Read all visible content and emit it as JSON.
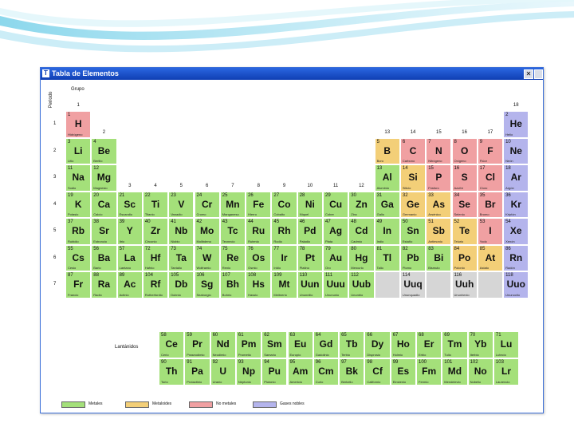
{
  "window": {
    "title": "Tabla de Elementos",
    "icon_name": "app-icon",
    "close_glyph": "✕"
  },
  "labels": {
    "periodo": "Periodo",
    "grupo": "Grupo",
    "lantanidos": "Lantánidos",
    "actinidos": "Actínidos",
    "lant_row": "6",
    "act_row": "7"
  },
  "groups": [
    "1",
    "2",
    "3",
    "4",
    "5",
    "6",
    "7",
    "8",
    "9",
    "10",
    "11",
    "12",
    "13",
    "14",
    "15",
    "16",
    "17",
    "18"
  ],
  "periods": [
    "1",
    "2",
    "3",
    "4",
    "5",
    "6",
    "7"
  ],
  "colors": {
    "metal": "#a4e07a",
    "metaloide": "#f3cf78",
    "nometal": "#f0a0a2",
    "noble": "#b4b4ec",
    "unknown": "#d6d6d6"
  },
  "legend": [
    {
      "label": "Metales",
      "cat": "metal"
    },
    {
      "label": "Metaloides",
      "cat": "metaloide"
    },
    {
      "label": "No metales",
      "cat": "nometal"
    },
    {
      "label": "Gases nobles",
      "cat": "noble"
    }
  ],
  "elements": [
    {
      "n": "1",
      "s": "H",
      "name": "Hidrógeno",
      "p": 1,
      "g": 1,
      "c": "nometal"
    },
    {
      "n": "2",
      "s": "He",
      "name": "Helio",
      "p": 1,
      "g": 18,
      "c": "noble"
    },
    {
      "n": "3",
      "s": "Li",
      "name": "Litio",
      "p": 2,
      "g": 1,
      "c": "metal"
    },
    {
      "n": "4",
      "s": "Be",
      "name": "Berilio",
      "p": 2,
      "g": 2,
      "c": "metal"
    },
    {
      "n": "5",
      "s": "B",
      "name": "Boro",
      "p": 2,
      "g": 13,
      "c": "metaloide"
    },
    {
      "n": "6",
      "s": "C",
      "name": "Carbono",
      "p": 2,
      "g": 14,
      "c": "nometal"
    },
    {
      "n": "7",
      "s": "N",
      "name": "Nitrógeno",
      "p": 2,
      "g": 15,
      "c": "nometal"
    },
    {
      "n": "8",
      "s": "O",
      "name": "Oxígeno",
      "p": 2,
      "g": 16,
      "c": "nometal"
    },
    {
      "n": "9",
      "s": "F",
      "name": "Flúor",
      "p": 2,
      "g": 17,
      "c": "nometal"
    },
    {
      "n": "10",
      "s": "Ne",
      "name": "Neón",
      "p": 2,
      "g": 18,
      "c": "noble"
    },
    {
      "n": "11",
      "s": "Na",
      "name": "Sodio",
      "p": 3,
      "g": 1,
      "c": "metal"
    },
    {
      "n": "12",
      "s": "Mg",
      "name": "Magnesio",
      "p": 3,
      "g": 2,
      "c": "metal"
    },
    {
      "n": "13",
      "s": "Al",
      "name": "Aluminio",
      "p": 3,
      "g": 13,
      "c": "metal"
    },
    {
      "n": "14",
      "s": "Si",
      "name": "Silicio",
      "p": 3,
      "g": 14,
      "c": "metaloide"
    },
    {
      "n": "15",
      "s": "P",
      "name": "Fósforo",
      "p": 3,
      "g": 15,
      "c": "nometal"
    },
    {
      "n": "16",
      "s": "S",
      "name": "Azufre",
      "p": 3,
      "g": 16,
      "c": "nometal"
    },
    {
      "n": "17",
      "s": "Cl",
      "name": "Cloro",
      "p": 3,
      "g": 17,
      "c": "nometal"
    },
    {
      "n": "18",
      "s": "Ar",
      "name": "Argón",
      "p": 3,
      "g": 18,
      "c": "noble"
    },
    {
      "n": "19",
      "s": "K",
      "name": "Potasio",
      "p": 4,
      "g": 1,
      "c": "metal"
    },
    {
      "n": "20",
      "s": "Ca",
      "name": "Calcio",
      "p": 4,
      "g": 2,
      "c": "metal"
    },
    {
      "n": "21",
      "s": "Sc",
      "name": "Escandio",
      "p": 4,
      "g": 3,
      "c": "metal"
    },
    {
      "n": "22",
      "s": "Ti",
      "name": "Titanio",
      "p": 4,
      "g": 4,
      "c": "metal"
    },
    {
      "n": "23",
      "s": "V",
      "name": "Vanadio",
      "p": 4,
      "g": 5,
      "c": "metal"
    },
    {
      "n": "24",
      "s": "Cr",
      "name": "Cromo",
      "p": 4,
      "g": 6,
      "c": "metal"
    },
    {
      "n": "25",
      "s": "Mn",
      "name": "Manganeso",
      "p": 4,
      "g": 7,
      "c": "metal"
    },
    {
      "n": "26",
      "s": "Fe",
      "name": "Hierro",
      "p": 4,
      "g": 8,
      "c": "metal"
    },
    {
      "n": "27",
      "s": "Co",
      "name": "Cobalto",
      "p": 4,
      "g": 9,
      "c": "metal"
    },
    {
      "n": "28",
      "s": "Ni",
      "name": "Níquel",
      "p": 4,
      "g": 10,
      "c": "metal"
    },
    {
      "n": "29",
      "s": "Cu",
      "name": "Cobre",
      "p": 4,
      "g": 11,
      "c": "metal"
    },
    {
      "n": "30",
      "s": "Zn",
      "name": "Zinc",
      "p": 4,
      "g": 12,
      "c": "metal"
    },
    {
      "n": "31",
      "s": "Ga",
      "name": "Galio",
      "p": 4,
      "g": 13,
      "c": "metal"
    },
    {
      "n": "32",
      "s": "Ge",
      "name": "Germanio",
      "p": 4,
      "g": 14,
      "c": "metaloide"
    },
    {
      "n": "33",
      "s": "As",
      "name": "Arsénico",
      "p": 4,
      "g": 15,
      "c": "metaloide"
    },
    {
      "n": "34",
      "s": "Se",
      "name": "Selenio",
      "p": 4,
      "g": 16,
      "c": "nometal"
    },
    {
      "n": "35",
      "s": "Br",
      "name": "Bromo",
      "p": 4,
      "g": 17,
      "c": "nometal"
    },
    {
      "n": "36",
      "s": "Kr",
      "name": "Kriptón",
      "p": 4,
      "g": 18,
      "c": "noble"
    },
    {
      "n": "37",
      "s": "Rb",
      "name": "Rubidio",
      "p": 5,
      "g": 1,
      "c": "metal"
    },
    {
      "n": "38",
      "s": "Sr",
      "name": "Estroncio",
      "p": 5,
      "g": 2,
      "c": "metal"
    },
    {
      "n": "39",
      "s": "Y",
      "name": "Itrio",
      "p": 5,
      "g": 3,
      "c": "metal"
    },
    {
      "n": "40",
      "s": "Zr",
      "name": "Circonio",
      "p": 5,
      "g": 4,
      "c": "metal"
    },
    {
      "n": "41",
      "s": "Nb",
      "name": "Niobio",
      "p": 5,
      "g": 5,
      "c": "metal"
    },
    {
      "n": "42",
      "s": "Mo",
      "name": "Molibdeno",
      "p": 5,
      "g": 6,
      "c": "metal"
    },
    {
      "n": "43",
      "s": "Tc",
      "name": "Tecnecio",
      "p": 5,
      "g": 7,
      "c": "metal"
    },
    {
      "n": "44",
      "s": "Ru",
      "name": "Rutenio",
      "p": 5,
      "g": 8,
      "c": "metal"
    },
    {
      "n": "45",
      "s": "Rh",
      "name": "Rodio",
      "p": 5,
      "g": 9,
      "c": "metal"
    },
    {
      "n": "46",
      "s": "Pd",
      "name": "Paladio",
      "p": 5,
      "g": 10,
      "c": "metal"
    },
    {
      "n": "47",
      "s": "Ag",
      "name": "Plata",
      "p": 5,
      "g": 11,
      "c": "metal"
    },
    {
      "n": "48",
      "s": "Cd",
      "name": "Cadmio",
      "p": 5,
      "g": 12,
      "c": "metal"
    },
    {
      "n": "49",
      "s": "In",
      "name": "Indio",
      "p": 5,
      "g": 13,
      "c": "metal"
    },
    {
      "n": "50",
      "s": "Sn",
      "name": "Estaño",
      "p": 5,
      "g": 14,
      "c": "metal"
    },
    {
      "n": "51",
      "s": "Sb",
      "name": "Antimonio",
      "p": 5,
      "g": 15,
      "c": "metaloide"
    },
    {
      "n": "52",
      "s": "Te",
      "name": "Telurio",
      "p": 5,
      "g": 16,
      "c": "metaloide"
    },
    {
      "n": "53",
      "s": "I",
      "name": "Yodo",
      "p": 5,
      "g": 17,
      "c": "nometal"
    },
    {
      "n": "54",
      "s": "Xe",
      "name": "Xenón",
      "p": 5,
      "g": 18,
      "c": "noble"
    },
    {
      "n": "55",
      "s": "Cs",
      "name": "Cesio",
      "p": 6,
      "g": 1,
      "c": "metal"
    },
    {
      "n": "56",
      "s": "Ba",
      "name": "Bario",
      "p": 6,
      "g": 2,
      "c": "metal"
    },
    {
      "n": "57",
      "s": "La",
      "name": "Lantano",
      "p": 6,
      "g": 3,
      "c": "metal"
    },
    {
      "n": "72",
      "s": "Hf",
      "name": "Hafnio",
      "p": 6,
      "g": 4,
      "c": "metal"
    },
    {
      "n": "73",
      "s": "Ta",
      "name": "Tantalio",
      "p": 6,
      "g": 5,
      "c": "metal"
    },
    {
      "n": "74",
      "s": "W",
      "name": "Wolframio",
      "p": 6,
      "g": 6,
      "c": "metal"
    },
    {
      "n": "75",
      "s": "Re",
      "name": "Renio",
      "p": 6,
      "g": 7,
      "c": "metal"
    },
    {
      "n": "76",
      "s": "Os",
      "name": "Osmio",
      "p": 6,
      "g": 8,
      "c": "metal"
    },
    {
      "n": "77",
      "s": "Ir",
      "name": "Iridio",
      "p": 6,
      "g": 9,
      "c": "metal"
    },
    {
      "n": "78",
      "s": "Pt",
      "name": "Platino",
      "p": 6,
      "g": 10,
      "c": "metal"
    },
    {
      "n": "79",
      "s": "Au",
      "name": "Oro",
      "p": 6,
      "g": 11,
      "c": "metal"
    },
    {
      "n": "80",
      "s": "Hg",
      "name": "Mercurio",
      "p": 6,
      "g": 12,
      "c": "metal"
    },
    {
      "n": "81",
      "s": "Tl",
      "name": "Talio",
      "p": 6,
      "g": 13,
      "c": "metal"
    },
    {
      "n": "82",
      "s": "Pb",
      "name": "Plomo",
      "p": 6,
      "g": 14,
      "c": "metal"
    },
    {
      "n": "83",
      "s": "Bi",
      "name": "Bismuto",
      "p": 6,
      "g": 15,
      "c": "metal"
    },
    {
      "n": "84",
      "s": "Po",
      "name": "Polonio",
      "p": 6,
      "g": 16,
      "c": "metaloide"
    },
    {
      "n": "85",
      "s": "At",
      "name": "Astato",
      "p": 6,
      "g": 17,
      "c": "metaloide"
    },
    {
      "n": "86",
      "s": "Rn",
      "name": "Radón",
      "p": 6,
      "g": 18,
      "c": "noble"
    },
    {
      "n": "87",
      "s": "Fr",
      "name": "Francio",
      "p": 7,
      "g": 1,
      "c": "metal"
    },
    {
      "n": "88",
      "s": "Ra",
      "name": "Radio",
      "p": 7,
      "g": 2,
      "c": "metal"
    },
    {
      "n": "89",
      "s": "Ac",
      "name": "Actinio",
      "p": 7,
      "g": 3,
      "c": "metal"
    },
    {
      "n": "104",
      "s": "Rf",
      "name": "Rutherfordio",
      "p": 7,
      "g": 4,
      "c": "metal"
    },
    {
      "n": "105",
      "s": "Db",
      "name": "Dubnio",
      "p": 7,
      "g": 5,
      "c": "metal"
    },
    {
      "n": "106",
      "s": "Sg",
      "name": "Seaborgio",
      "p": 7,
      "g": 6,
      "c": "metal"
    },
    {
      "n": "107",
      "s": "Bh",
      "name": "Bohrio",
      "p": 7,
      "g": 7,
      "c": "metal"
    },
    {
      "n": "108",
      "s": "Hs",
      "name": "Hassio",
      "p": 7,
      "g": 8,
      "c": "metal"
    },
    {
      "n": "109",
      "s": "Mt",
      "name": "Meitnerio",
      "p": 7,
      "g": 9,
      "c": "metal"
    },
    {
      "n": "110",
      "s": "Uun",
      "name": "Ununnilio",
      "p": 7,
      "g": 10,
      "c": "metal"
    },
    {
      "n": "111",
      "s": "Uuu",
      "name": "Unununio",
      "p": 7,
      "g": 11,
      "c": "metal"
    },
    {
      "n": "112",
      "s": "Uub",
      "name": "Ununbio",
      "p": 7,
      "g": 12,
      "c": "metal"
    },
    {
      "n": "",
      "s": "",
      "name": "",
      "p": 7,
      "g": 13,
      "c": "unknown"
    },
    {
      "n": "114",
      "s": "Uuq",
      "name": "Ununquadio",
      "p": 7,
      "g": 14,
      "c": "unknown"
    },
    {
      "n": "",
      "s": "",
      "name": "",
      "p": 7,
      "g": 15,
      "c": "unknown"
    },
    {
      "n": "116",
      "s": "Uuh",
      "name": "Ununhexio",
      "p": 7,
      "g": 16,
      "c": "unknown"
    },
    {
      "n": "",
      "s": "",
      "name": "",
      "p": 7,
      "g": 17,
      "c": "unknown"
    },
    {
      "n": "118",
      "s": "Uuo",
      "name": "Ununoctio",
      "p": 7,
      "g": 18,
      "c": "noble"
    }
  ],
  "lanthanides": [
    {
      "n": "58",
      "s": "Ce",
      "name": "Cerio"
    },
    {
      "n": "59",
      "s": "Pr",
      "name": "Praseodimio"
    },
    {
      "n": "60",
      "s": "Nd",
      "name": "Neodimio"
    },
    {
      "n": "61",
      "s": "Pm",
      "name": "Prometio"
    },
    {
      "n": "62",
      "s": "Sm",
      "name": "Samario"
    },
    {
      "n": "63",
      "s": "Eu",
      "name": "Europio"
    },
    {
      "n": "64",
      "s": "Gd",
      "name": "Gadolinio"
    },
    {
      "n": "65",
      "s": "Tb",
      "name": "Terbio"
    },
    {
      "n": "66",
      "s": "Dy",
      "name": "Disprosio"
    },
    {
      "n": "67",
      "s": "Ho",
      "name": "Holmio"
    },
    {
      "n": "68",
      "s": "Er",
      "name": "Erbio"
    },
    {
      "n": "69",
      "s": "Tm",
      "name": "Tulio"
    },
    {
      "n": "70",
      "s": "Yb",
      "name": "Iterbio"
    },
    {
      "n": "71",
      "s": "Lu",
      "name": "Lutecio"
    }
  ],
  "actinides": [
    {
      "n": "90",
      "s": "Th",
      "name": "Torio"
    },
    {
      "n": "91",
      "s": "Pa",
      "name": "Protactinio"
    },
    {
      "n": "92",
      "s": "U",
      "name": "Uranio"
    },
    {
      "n": "93",
      "s": "Np",
      "name": "Neptunio"
    },
    {
      "n": "94",
      "s": "Pu",
      "name": "Plutonio"
    },
    {
      "n": "95",
      "s": "Am",
      "name": "Americio"
    },
    {
      "n": "96",
      "s": "Cm",
      "name": "Curio"
    },
    {
      "n": "97",
      "s": "Bk",
      "name": "Berkelio"
    },
    {
      "n": "98",
      "s": "Cf",
      "name": "Californio"
    },
    {
      "n": "99",
      "s": "Es",
      "name": "Einstenio"
    },
    {
      "n": "100",
      "s": "Fm",
      "name": "Fermio"
    },
    {
      "n": "101",
      "s": "Md",
      "name": "Mendelevio"
    },
    {
      "n": "102",
      "s": "No",
      "name": "Nobelio"
    },
    {
      "n": "103",
      "s": "Lr",
      "name": "Laurencio"
    }
  ]
}
